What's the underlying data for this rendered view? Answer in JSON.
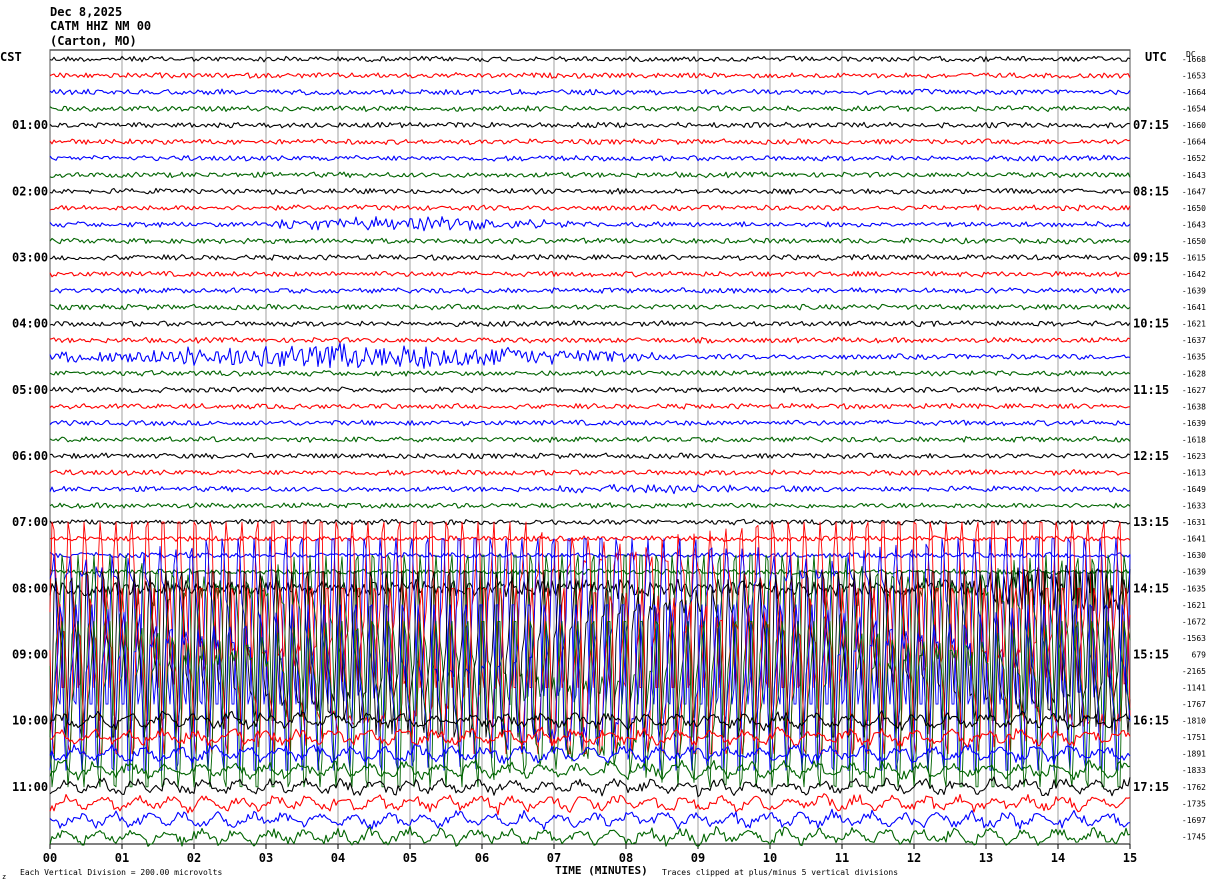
{
  "chart_data": {
    "type": "line",
    "header": {
      "date": "Dec 8,2025",
      "station": "CATM HHZ NM 00",
      "location": "(Carton, MO)"
    },
    "left_axis_label": "CST",
    "right_axis_label": "UTC",
    "dc_label": "DC",
    "left_time_labels": [
      "01:00",
      "02:00",
      "03:00",
      "04:00",
      "05:00",
      "06:00",
      "07:00",
      "08:00",
      "09:00",
      "10:00",
      "11:00"
    ],
    "right_time_labels": [
      "07:15",
      "08:15",
      "09:15",
      "10:15",
      "11:15",
      "12:15",
      "13:15",
      "14:15",
      "15:15",
      "16:15",
      "17:15"
    ],
    "dc_offsets": [
      "-1668",
      "-1653",
      "-1664",
      "-1654",
      "-1660",
      "-1664",
      "-1652",
      "-1643",
      "-1647",
      "-1650",
      "-1643",
      "-1650",
      "-1615",
      "-1642",
      "-1639",
      "-1641",
      "-1621",
      "-1637",
      "-1635",
      "-1628",
      "-1627",
      "-1638",
      "-1639",
      "-1618",
      "-1623",
      "-1613",
      "-1649",
      "-1633",
      "-1631",
      "-1641",
      "-1630",
      "-1639",
      "-1635",
      "-1621",
      "-1672",
      "-1563",
      "679",
      "-2165",
      "-1141",
      "-1767",
      "-1810",
      "-1751",
      "-1891",
      "-1833",
      "-1762",
      "-1735",
      "-1697",
      "-1745"
    ],
    "xlabel": "TIME (MINUTES)",
    "x_ticks": [
      "00",
      "01",
      "02",
      "03",
      "04",
      "05",
      "06",
      "07",
      "08",
      "09",
      "10",
      "11",
      "12",
      "13",
      "14",
      "15"
    ],
    "xlim": [
      0,
      15
    ],
    "trace_colors": [
      "#000000",
      "#ff0000",
      "#0000ff",
      "#006400"
    ],
    "footer_left": "Each Vertical Division =  200.00 microvolts",
    "footer_right": "Traces clipped at plus/minus 5 vertical divisions",
    "corner_mark": "z",
    "events": [
      {
        "trace": 10,
        "start_min": 2.6,
        "end_min": 7.2,
        "level": 0.3
      },
      {
        "trace": 18,
        "start_min": 0.0,
        "end_min": 8.5,
        "level": 0.55
      },
      {
        "trace": 26,
        "start_min": 7.0,
        "end_min": 10.5,
        "level": 0.15
      }
    ],
    "noise_onset_trace": 32,
    "clipped_traces": [
      33,
      34,
      35,
      36,
      37,
      38,
      39
    ]
  }
}
